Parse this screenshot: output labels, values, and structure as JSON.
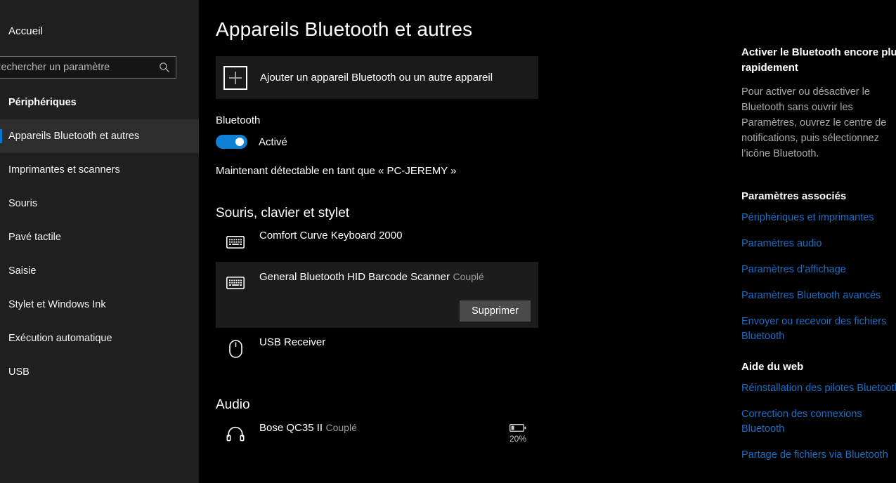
{
  "sidebar": {
    "home_label": "Accueil",
    "search": {
      "placeholder": "Rechercher un paramètre",
      "value": "",
      "icon": "search-icon"
    },
    "category_title": "Périphériques",
    "items": [
      {
        "label": "Appareils Bluetooth et autres",
        "selected": true
      },
      {
        "label": "Imprimantes et scanners",
        "selected": false
      },
      {
        "label": "Souris",
        "selected": false
      },
      {
        "label": "Pavé tactile",
        "selected": false
      },
      {
        "label": "Saisie",
        "selected": false
      },
      {
        "label": "Stylet et Windows Ink",
        "selected": false
      },
      {
        "label": "Exécution automatique",
        "selected": false
      },
      {
        "label": "USB",
        "selected": false
      }
    ]
  },
  "main": {
    "page_title": "Appareils Bluetooth et autres",
    "add_device": {
      "label": "Ajouter un appareil Bluetooth ou un autre appareil",
      "icon": "plus-icon"
    },
    "bluetooth": {
      "label": "Bluetooth",
      "toggle_state": "Activé",
      "toggle_on": true,
      "discoverable_text": "Maintenant détectable en tant que « PC-JEREMY »"
    },
    "groups": [
      {
        "title": "Souris, clavier et stylet",
        "devices": [
          {
            "name": "Comfort Curve Keyboard 2000",
            "status": "",
            "icon": "keyboard-icon",
            "selected": false,
            "battery": null
          },
          {
            "name": "General Bluetooth HID Barcode Scanner",
            "status": "Couplé",
            "icon": "keyboard-icon",
            "selected": true,
            "battery": null,
            "remove_label": "Supprimer"
          },
          {
            "name": "USB Receiver",
            "status": "",
            "icon": "mouse-icon",
            "selected": false,
            "battery": null
          }
        ]
      },
      {
        "title": "Audio",
        "devices": [
          {
            "name": "Bose QC35 II",
            "status": "Couplé",
            "icon": "headphones-icon",
            "selected": false,
            "battery": "20%"
          }
        ]
      }
    ]
  },
  "right_panel": {
    "tip_title_line1": "Activer le Bluetooth encore plus",
    "tip_title_line2": "rapidement",
    "tip_body_lines": [
      "Pour activer ou désactiver le",
      "Bluetooth sans ouvrir les",
      "Paramètres, ouvrez le centre de",
      "notifications, puis sélectionnez",
      "l’icône Bluetooth."
    ],
    "related_title": "Paramètres associés",
    "related_links": [
      "Périphériques et imprimantes",
      "Paramètres audio",
      "Paramètres d’affichage",
      "Paramètres Bluetooth avancés",
      "Envoyer ou recevoir des fichiers Bluetooth"
    ],
    "help_title": "Aide du web",
    "help_links": [
      "Réinstallation des pilotes Bluetooth",
      "Correction des connexions Bluetooth",
      "Partage de fichiers via Bluetooth"
    ]
  },
  "colors": {
    "accent": "#0078d7",
    "link": "#1a6ec4",
    "sidebar_bg": "#1f1f1f",
    "main_bg": "#000000",
    "selected_row_bg": "#1c1c1c",
    "button_bg": "#4a4a4a"
  }
}
